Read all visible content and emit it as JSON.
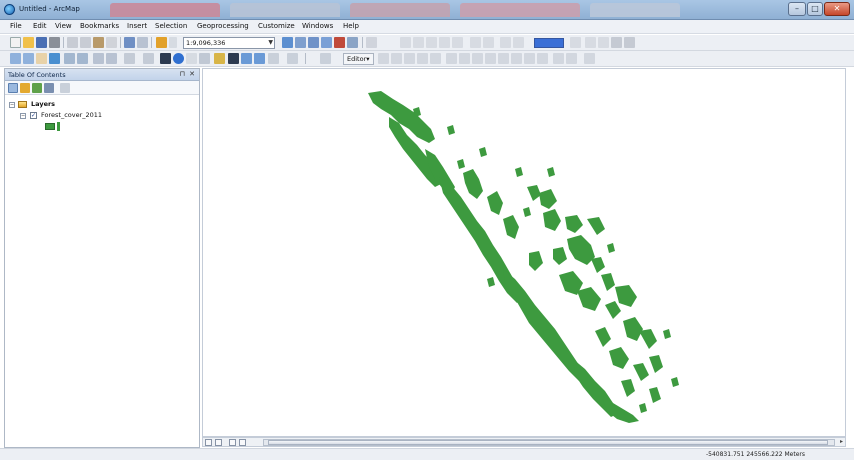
{
  "window": {
    "title": "Untitled - ArcMap",
    "controls": {
      "minimize": "–",
      "maximize": "□",
      "close": "✕"
    }
  },
  "menubar": [
    "File",
    "Edit",
    "View",
    "Bookmarks",
    "Insert",
    "Selection",
    "Geoprocessing",
    "Customize",
    "Windows",
    "Help"
  ],
  "toolbar": {
    "scale_value": "1:9,096,336",
    "editor_label": "Editor▾"
  },
  "toc": {
    "title": "Table Of Contents",
    "pin": "⊓",
    "close": "✕",
    "tree": {
      "root_label": "Layers",
      "layer_label": "Forest_cover_2011",
      "layer_checked": "✓"
    }
  },
  "map": {
    "forest_color": "#3d9a3f"
  },
  "statusbar": {
    "coordinates": "-540831.751  245566.222 Meters"
  },
  "colors": {
    "accent": "#3a6fd6",
    "forest": "#3d9a3f",
    "title_bar": "#a9c6e4"
  }
}
